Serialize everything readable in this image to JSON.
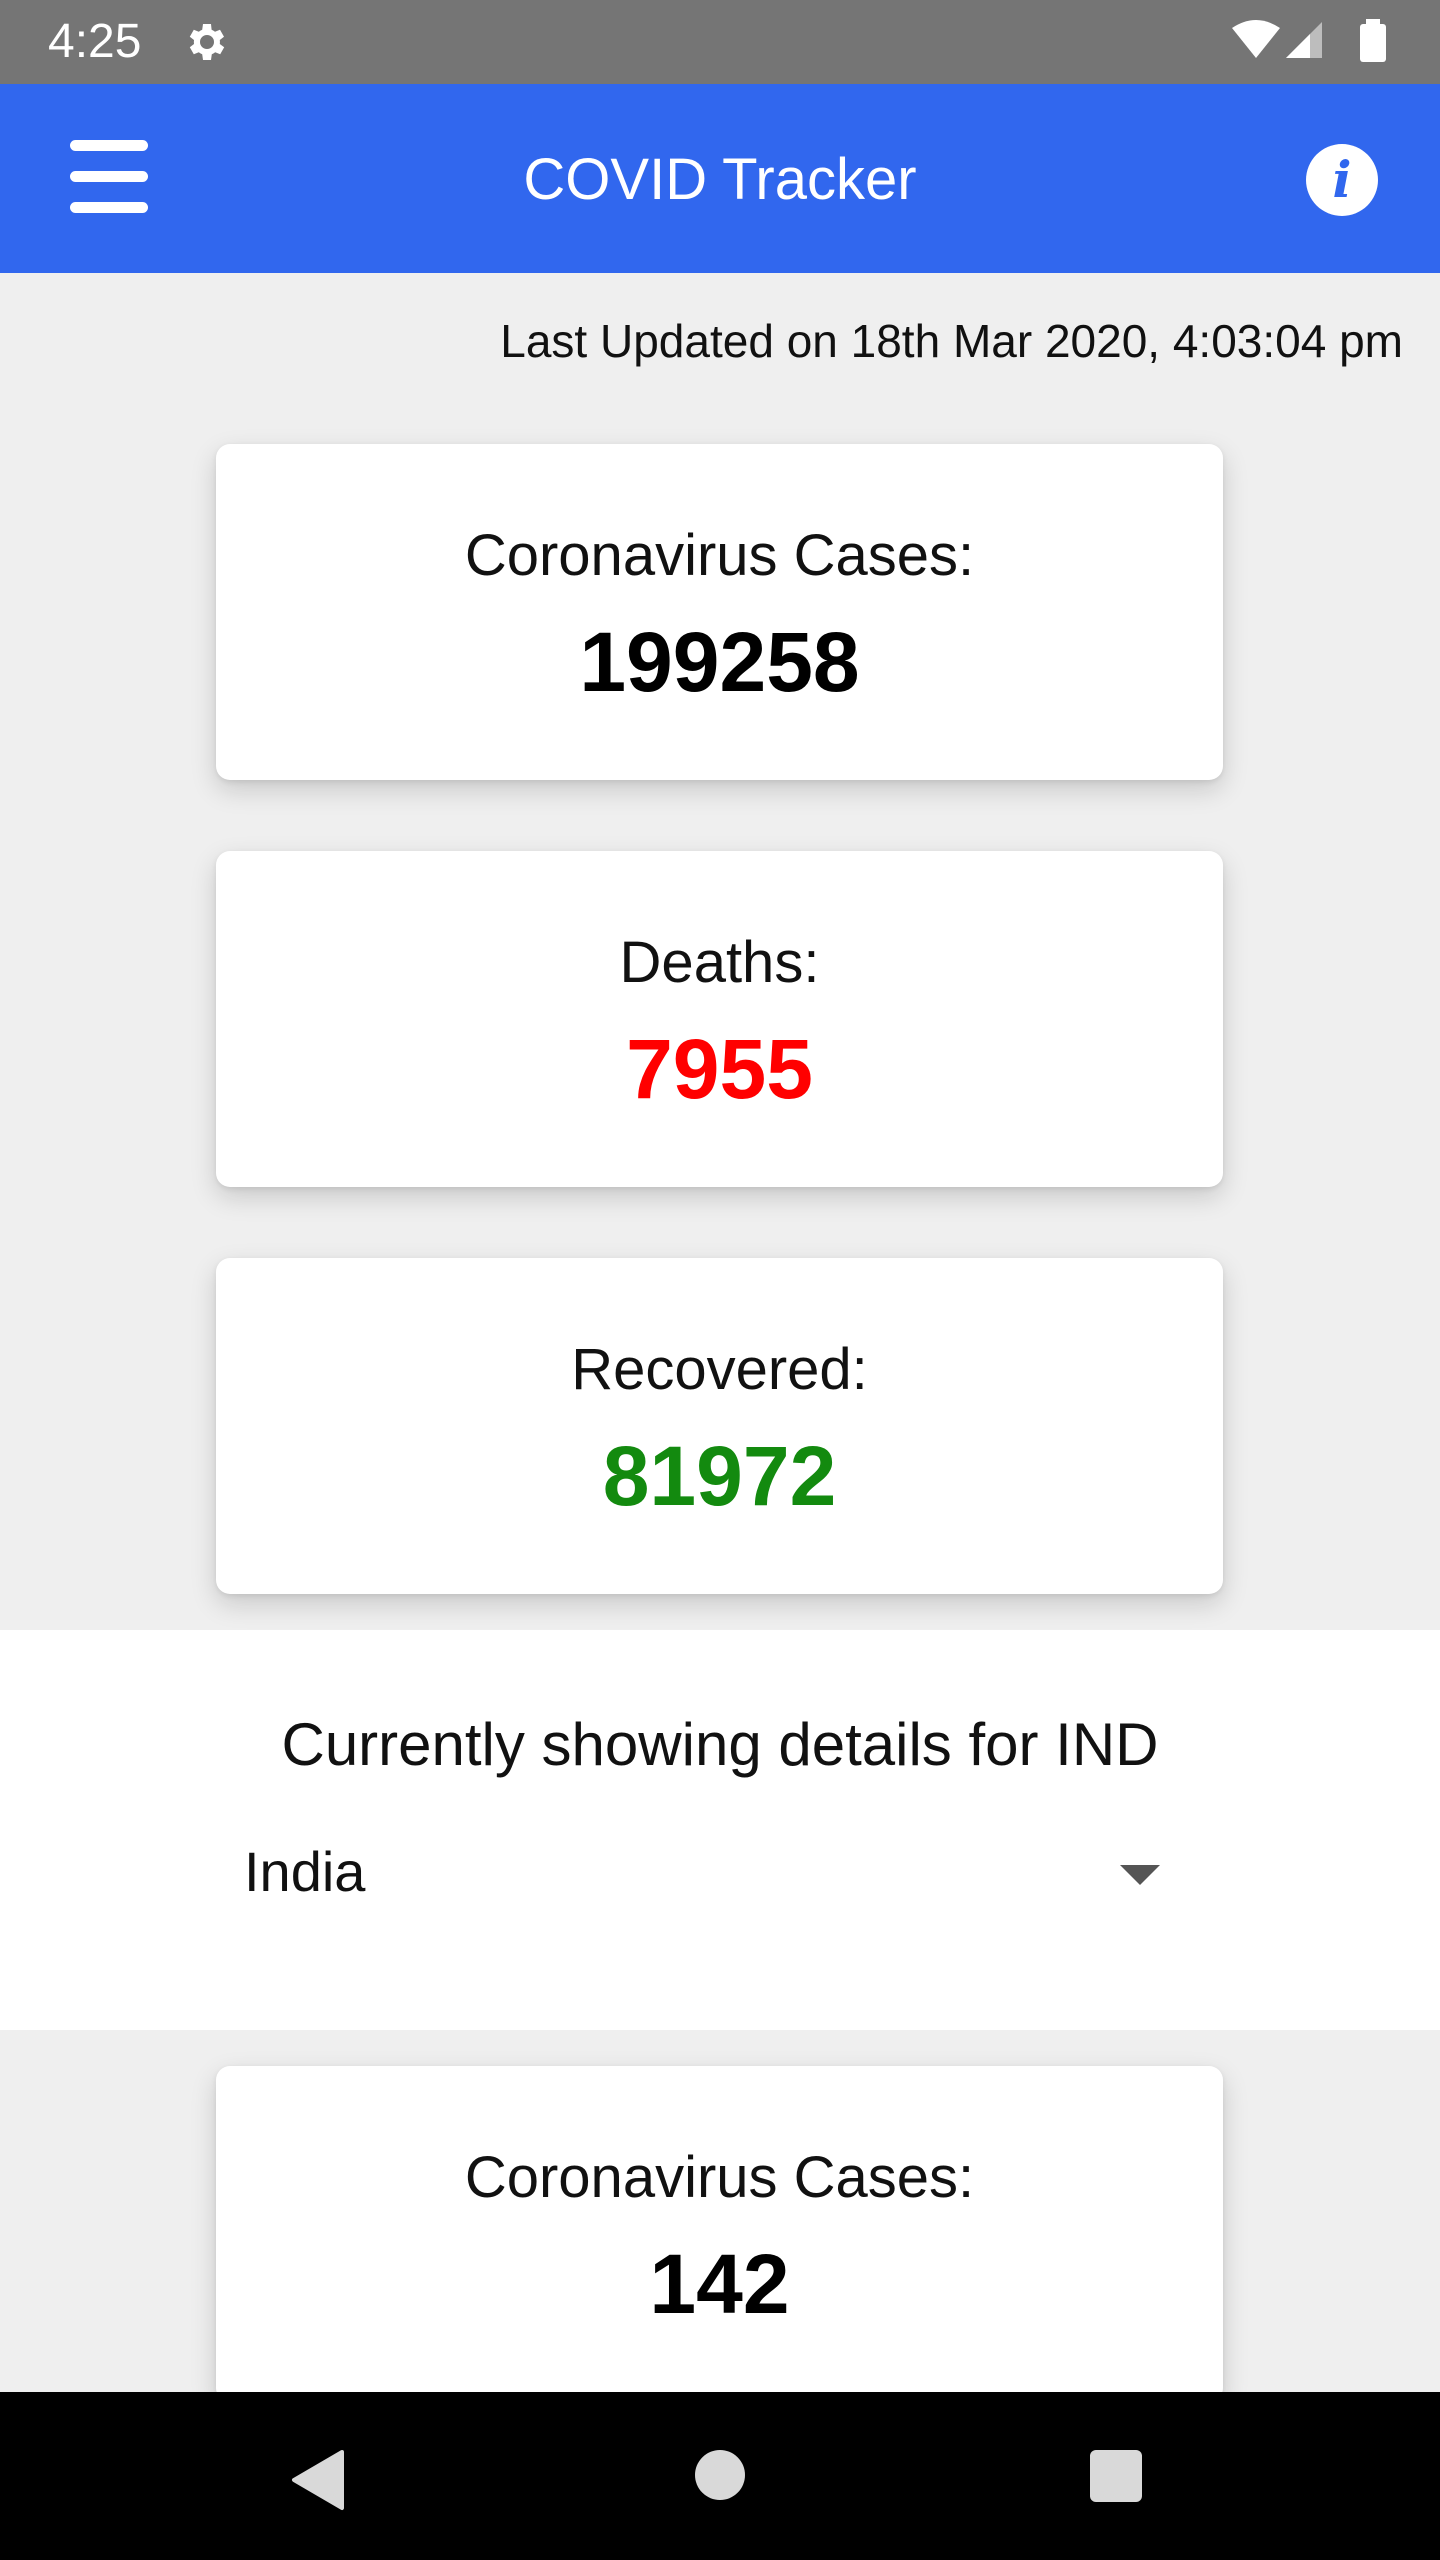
{
  "status_bar": {
    "time": "4:25"
  },
  "app_bar": {
    "title": "COVID Tracker",
    "info_symbol": "i"
  },
  "last_updated": "Last Updated on 18th Mar 2020, 4:03:04 pm",
  "global_stats": [
    {
      "label": "Coronavirus Cases:",
      "value": "199258",
      "color": "#000000"
    },
    {
      "label": "Deaths:",
      "value": "7955",
      "color": "#ff0000"
    },
    {
      "label": "Recovered:",
      "value": "81972",
      "color": "#138a0f"
    }
  ],
  "country_section": {
    "showing_text": "Currently showing details for IND",
    "selected_country": "India"
  },
  "country_stats": [
    {
      "label": "Coronavirus Cases:",
      "value": "142",
      "color": "#000000"
    }
  ],
  "colors": {
    "accent": "#3167ee",
    "status_bar": "#757575"
  }
}
